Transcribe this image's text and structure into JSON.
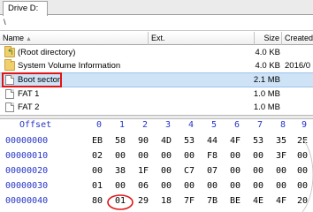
{
  "tabs": [
    {
      "label": "Drive D:"
    }
  ],
  "path": "\\",
  "columns": {
    "name": "Name",
    "ext": "Ext.",
    "size": "Size",
    "created": "Created"
  },
  "rows": [
    {
      "name": "(Root directory)",
      "size": "4.0 KB",
      "created": "",
      "icon": "folder-up-icon",
      "selected": false
    },
    {
      "name": "System Volume Information",
      "size": "4.0 KB",
      "created": "2016/0",
      "icon": "folder-icon",
      "selected": false
    },
    {
      "name": "Boot sector",
      "size": "2.1 MB",
      "created": "",
      "icon": "file-icon",
      "selected": true
    },
    {
      "name": "FAT 1",
      "size": "1.0 MB",
      "created": "",
      "icon": "file-icon",
      "selected": false
    },
    {
      "name": "FAT 2",
      "size": "1.0 MB",
      "created": "",
      "icon": "file-icon",
      "selected": false
    }
  ],
  "hex": {
    "offset_label": "Offset",
    "columns": [
      "0",
      "1",
      "2",
      "3",
      "4",
      "5",
      "6",
      "7",
      "8",
      "9"
    ],
    "rows": [
      {
        "offset": "00000000",
        "bytes": [
          "EB",
          "58",
          "90",
          "4D",
          "53",
          "44",
          "4F",
          "53",
          "35",
          "2E"
        ]
      },
      {
        "offset": "00000010",
        "bytes": [
          "02",
          "00",
          "00",
          "00",
          "00",
          "F8",
          "00",
          "00",
          "3F",
          "00"
        ]
      },
      {
        "offset": "00000020",
        "bytes": [
          "00",
          "38",
          "1F",
          "00",
          "C7",
          "07",
          "00",
          "00",
          "00",
          "00"
        ]
      },
      {
        "offset": "00000030",
        "bytes": [
          "01",
          "00",
          "06",
          "00",
          "00",
          "00",
          "00",
          "00",
          "00",
          "00"
        ]
      },
      {
        "offset": "00000040",
        "bytes": [
          "80",
          "01",
          "29",
          "18",
          "7F",
          "7B",
          "BE",
          "4E",
          "4F",
          "20"
        ]
      }
    ]
  },
  "accent_colors": {
    "highlight_box": "#e01515",
    "offset_text": "#2535c8",
    "selection": "#cfe3f7"
  }
}
